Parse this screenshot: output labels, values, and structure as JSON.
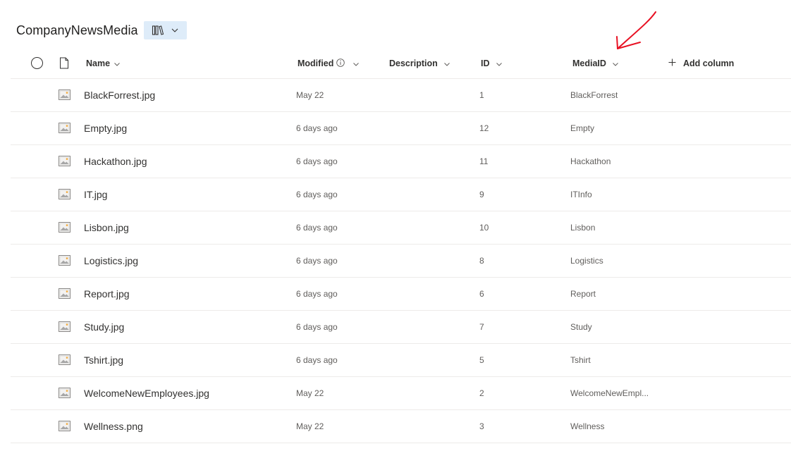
{
  "library": {
    "title": "CompanyNewsMedia",
    "view_icon": "library-view-icon",
    "view_dropdown_icon": "chevron-down-icon"
  },
  "columns": {
    "name": "Name",
    "modified": "Modified",
    "description": "Description",
    "id": "ID",
    "mediaid": "MediaID",
    "add_column": "Add column"
  },
  "files": [
    {
      "name": "BlackForrest.jpg",
      "modified": "May 22",
      "id": "1",
      "mediaid": "BlackForrest"
    },
    {
      "name": "Empty.jpg",
      "modified": "6 days ago",
      "id": "12",
      "mediaid": "Empty"
    },
    {
      "name": "Hackathon.jpg",
      "modified": "6 days ago",
      "id": "11",
      "mediaid": "Hackathon"
    },
    {
      "name": "IT.jpg",
      "modified": "6 days ago",
      "id": "9",
      "mediaid": "ITInfo"
    },
    {
      "name": "Lisbon.jpg",
      "modified": "6 days ago",
      "id": "10",
      "mediaid": "Lisbon"
    },
    {
      "name": "Logistics.jpg",
      "modified": "6 days ago",
      "id": "8",
      "mediaid": "Logistics"
    },
    {
      "name": "Report.jpg",
      "modified": "6 days ago",
      "id": "6",
      "mediaid": "Report"
    },
    {
      "name": "Study.jpg",
      "modified": "6 days ago",
      "id": "7",
      "mediaid": "Study"
    },
    {
      "name": "Tshirt.jpg",
      "modified": "6 days ago",
      "id": "5",
      "mediaid": "Tshirt"
    },
    {
      "name": "WelcomeNewEmployees.jpg",
      "modified": "May 22",
      "id": "2",
      "mediaid": "WelcomeNewEmpl..."
    },
    {
      "name": "Wellness.png",
      "modified": "May 22",
      "id": "3",
      "mediaid": "Wellness"
    }
  ],
  "colors": {
    "accent_bg": "#deecf9",
    "arrow_annotation": "#e81123",
    "divider": "#edebe9"
  }
}
